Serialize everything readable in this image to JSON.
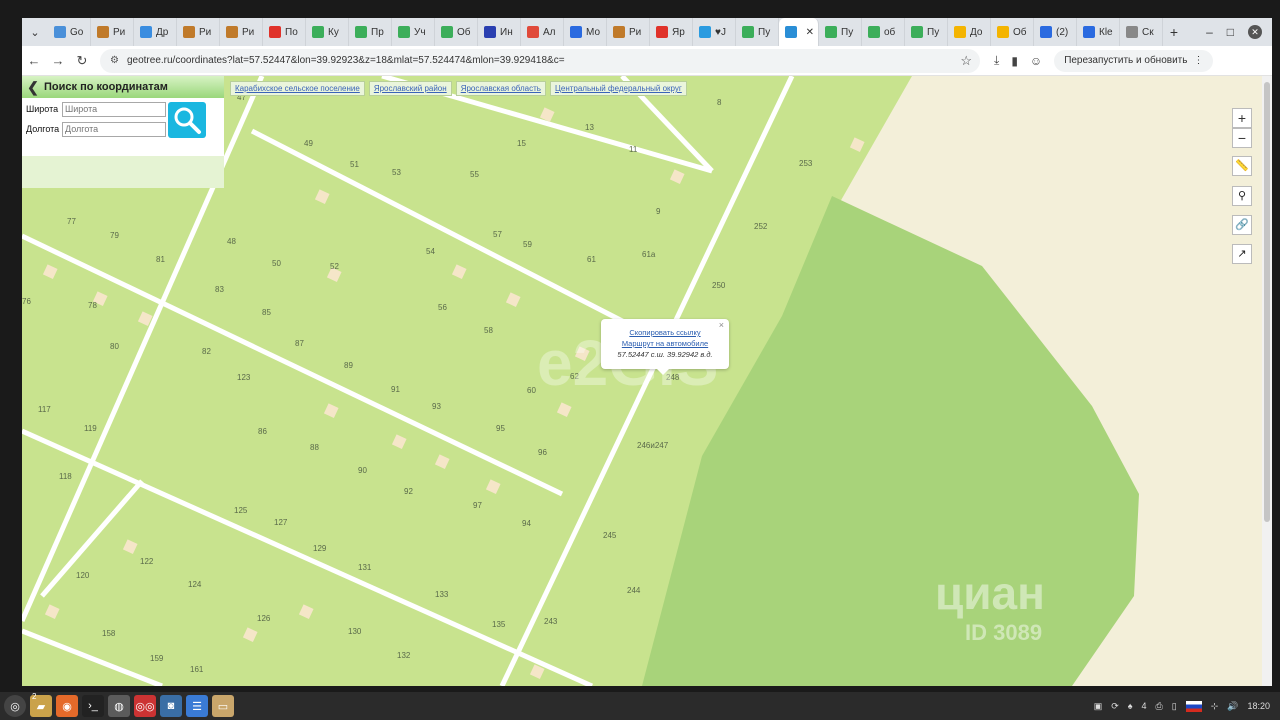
{
  "browser": {
    "tabs": [
      {
        "label": "Go",
        "color": "#4a90d9",
        "icon": "calendar-icon"
      },
      {
        "label": "Ри",
        "color": "#c07a2a",
        "icon": "avito-icon"
      },
      {
        "label": "Др",
        "color": "#3a8de0",
        "icon": "globe-icon"
      },
      {
        "label": "Ри",
        "color": "#c07a2a",
        "icon": "avito-icon"
      },
      {
        "label": "Ри",
        "color": "#c07a2a",
        "icon": "avito-icon"
      },
      {
        "label": "По",
        "color": "#e0322a",
        "icon": "map-pin-icon"
      },
      {
        "label": "Ку",
        "color": "#3cae5a",
        "icon": "avito-icon"
      },
      {
        "label": "Пр",
        "color": "#3cae5a",
        "icon": "avito-icon"
      },
      {
        "label": "Уч",
        "color": "#3cae5a",
        "icon": "avito-icon"
      },
      {
        "label": "Об",
        "color": "#3cae5a",
        "icon": "leaf-icon"
      },
      {
        "label": "Ин",
        "color": "#2a3fb0",
        "icon": "letter-icon"
      },
      {
        "label": "Ал",
        "color": "#e04a3a",
        "icon": "car-icon"
      },
      {
        "label": "Мо",
        "color": "#2a6ae0",
        "icon": "m-icon"
      },
      {
        "label": "Ри",
        "color": "#c07a2a",
        "icon": "avito-icon"
      },
      {
        "label": "Яр",
        "color": "#e0322a",
        "icon": "map-pin-icon"
      },
      {
        "label": "♥Ј",
        "color": "#2a9be0",
        "icon": "telegram-icon"
      },
      {
        "label": "Пу",
        "color": "#3cae5a",
        "icon": "route-icon"
      },
      {
        "label": "",
        "color": "#2a8ed6",
        "icon": "geotree-icon",
        "active": true
      },
      {
        "label": "Пу",
        "color": "#3cae5a",
        "icon": "check-icon"
      },
      {
        "label": "об",
        "color": "#3cae5a",
        "icon": "check-icon"
      },
      {
        "label": "Пу",
        "color": "#3cae5a",
        "icon": "check-icon"
      },
      {
        "label": "До",
        "color": "#f4b400",
        "icon": "drive-icon"
      },
      {
        "label": "Об",
        "color": "#f4b400",
        "icon": "slides-icon"
      },
      {
        "label": "(2)",
        "color": "#2a6ae0",
        "icon": "mail-icon"
      },
      {
        "label": "Кle",
        "color": "#2a6ae0",
        "icon": "k-icon"
      },
      {
        "label": "Ск",
        "color": "#888888",
        "icon": "globe-icon"
      }
    ],
    "new_tab": "+",
    "url": "geotree.ru/coordinates?lat=57.52447&lon=39.92923&z=18&mlat=57.524474&mlon=39.929418&c=",
    "restart_label": "Перезапустить и обновить"
  },
  "search": {
    "title": "Поиск по координатам",
    "lat_label": "Широта",
    "lat_placeholder": "Широта",
    "lon_label": "Долгота",
    "lon_placeholder": "Долгота"
  },
  "breadcrumbs": [
    "Карабихское сельское поселение",
    "Ярославский район",
    "Ярославская область",
    "Центральный федеральный округ"
  ],
  "map": {
    "colors": {
      "field": "#c8e38e",
      "forest": "#a8d37a",
      "sand": "#f3efd9",
      "road": "#ffffff",
      "house": "#f5e6c8"
    },
    "labels": [
      "47",
      "8",
      "13",
      "15",
      "11",
      "49",
      "51",
      "53",
      "55",
      "9",
      "253",
      "77",
      "79",
      "81",
      "48",
      "50",
      "52",
      "54",
      "57",
      "59",
      "61",
      "61а",
      "252",
      "250",
      "76",
      "78",
      "83",
      "85",
      "56",
      "58",
      "80",
      "82",
      "87",
      "89",
      "62",
      "123",
      "91",
      "93",
      "60",
      "117",
      "119",
      "86",
      "88",
      "95",
      "96",
      "246и247",
      "118",
      "90",
      "92",
      "97",
      "94",
      "125",
      "127",
      "245",
      "129",
      "131",
      "122",
      "120",
      "124",
      "133",
      "244",
      "158",
      "126",
      "130",
      "135",
      "243",
      "159",
      "161",
      "132",
      "248"
    ],
    "zoom_in": "+",
    "zoom_out": "−"
  },
  "popup": {
    "copy_link": "Скопировать ссылку",
    "route": "Маршрут на автомобиле",
    "coords": "57.52447 с.ш. 39.92942 в.д.",
    "close": "×"
  },
  "watermarks": {
    "egis": "e2GIS",
    "cian": "циан",
    "cian_id": "ID 3089"
  },
  "taskbar": {
    "workspace": "2",
    "tray_count": "4",
    "clock": "18:20"
  }
}
